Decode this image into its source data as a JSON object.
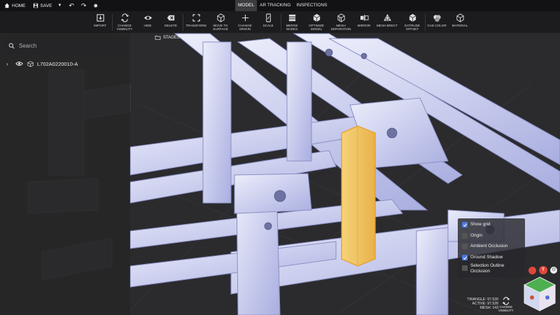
{
  "topbar": {
    "home_label": "HOME",
    "save_label": "SAVE",
    "save_dropdown_glyph": "▼",
    "undo_glyph": "↶",
    "redo_glyph": "↷",
    "settings_glyph": "✹",
    "mode_tabs": [
      {
        "label": "MODEL",
        "active": true
      },
      {
        "label": "AR TRACKING",
        "active": false
      },
      {
        "label": "INSPECTIONS",
        "active": false
      }
    ]
  },
  "toolbar": {
    "tools": [
      {
        "key": "import",
        "label": "IMPORT",
        "icon": "import-icon"
      },
      {
        "key": "change_visibility",
        "label": "CHANGE\nVISIBILITY",
        "icon": "visibility-swap-icon"
      },
      {
        "key": "hide",
        "label": "HIDE",
        "icon": "eye-icon"
      },
      {
        "key": "delete",
        "label": "DELETE",
        "icon": "delete-icon"
      },
      {
        "key": "transform",
        "label": "TRANSFORM",
        "icon": "transform-icon"
      },
      {
        "key": "move_to_surface",
        "label": "MOVE TO\nSURFACE",
        "icon": "cube-icon"
      },
      {
        "key": "change_origin",
        "label": "CHANGE\nORIGIN",
        "icon": "origin-icon"
      },
      {
        "key": "scale",
        "label": "SCALE",
        "icon": "scale-icon"
      },
      {
        "key": "merge_nodes",
        "label": "MERGE\nNODES",
        "icon": "merge-icon"
      },
      {
        "key": "optimize_model",
        "label": "OPTIMIZE\nMODEL",
        "icon": "optimize-icon"
      },
      {
        "key": "mesh_separation",
        "label": "MESH\nSEPARATION",
        "icon": "mesh-separation-icon"
      },
      {
        "key": "mirror",
        "label": "MIRROR",
        "icon": "mirror-icon"
      },
      {
        "key": "mesh_brect",
        "label": "MESH BRECT",
        "icon": "mesh-brect-icon"
      },
      {
        "key": "extrude_offset",
        "label": "EXTRUDE\nOFFSET",
        "icon": "extrude-icon"
      },
      {
        "key": "cad_color",
        "label": "CAD COLOR",
        "icon": "color-icon"
      },
      {
        "key": "material",
        "label": "MATERIAL",
        "icon": "material-icon"
      }
    ]
  },
  "left_panel": {
    "search_placeholder": "Search",
    "tree": [
      {
        "caret": "›",
        "name": "L702A0220010-A"
      }
    ]
  },
  "viewport": {
    "stages_label": "STAGES",
    "selection_color": "#f2c15a",
    "model_color": "#dcdff7"
  },
  "settings_panel": {
    "options": [
      {
        "label": "Show grid",
        "checked": true
      },
      {
        "label": "Origin",
        "checked": false
      },
      {
        "label": "Ambient Occlusion",
        "checked": false
      },
      {
        "label": "Ground Shadow",
        "checked": true
      },
      {
        "label": "Selection Outline Occlusion",
        "checked": false
      }
    ]
  },
  "stats": {
    "triangle_label": "TRIANGLE: 97.526",
    "active_label": "ACTIVE: 97.526",
    "mesh_label": "MESH: 143"
  },
  "bottom_controls": {
    "change_visibility_label": "CHANGE\nVISIBILITY",
    "record_color": "#e0473a",
    "top_view_glyph": "T",
    "home_view_glyph": "⊙"
  }
}
